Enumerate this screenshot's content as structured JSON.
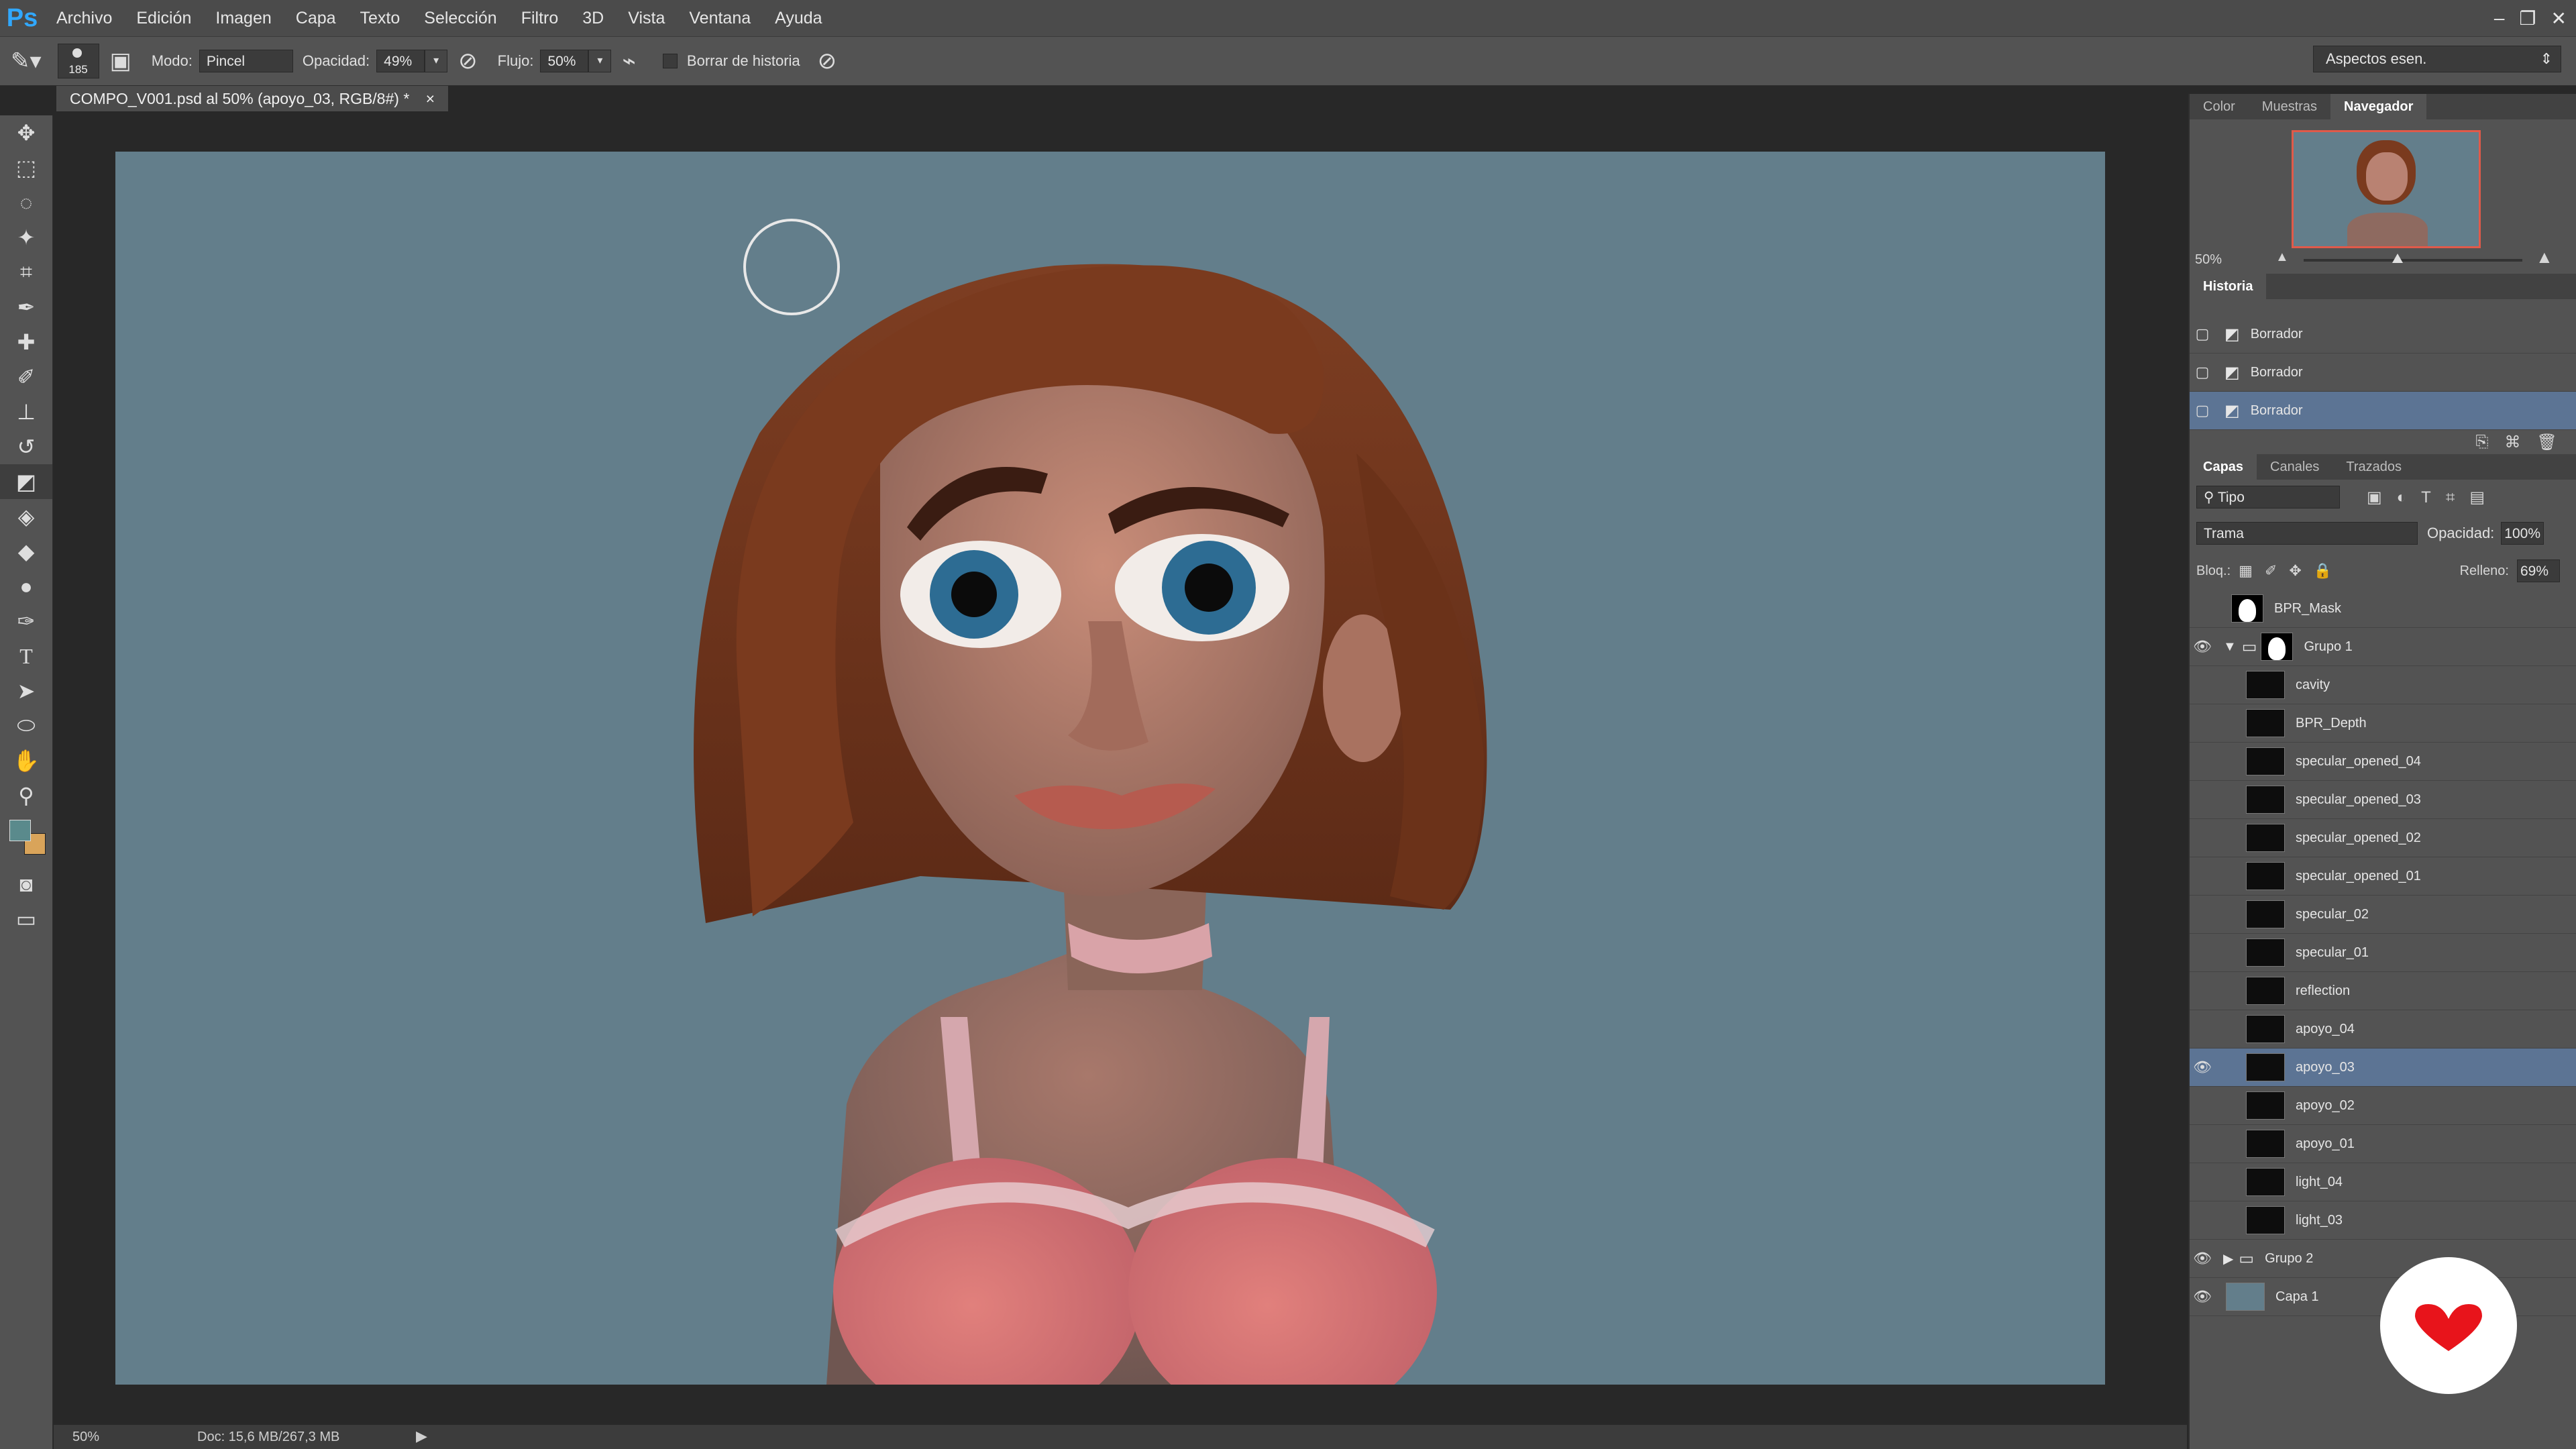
{
  "app": {
    "logo": "Ps"
  },
  "menu": [
    "Archivo",
    "Edición",
    "Imagen",
    "Capa",
    "Texto",
    "Selección",
    "Filtro",
    "3D",
    "Vista",
    "Ventana",
    "Ayuda"
  ],
  "window_controls": {
    "minimize": "‒",
    "restore": "❐",
    "close": "✕"
  },
  "options": {
    "brush_size": "185",
    "mode_label": "Modo:",
    "mode_value": "Pincel",
    "opacity_label": "Opacidad:",
    "opacity_value": "49%",
    "flow_label": "Flujo:",
    "flow_value": "50%",
    "erase_history_label": "Borrar de historia",
    "workspace": "Aspectos esen."
  },
  "document": {
    "tab_title": "COMPO_V001.psd al 50% (apoyo_03, RGB/8#) *",
    "tab_close": "×",
    "zoom": "50%",
    "doc_info": "Doc: 15,6 MB/267,3 MB",
    "canvas_color": "#637e8b"
  },
  "tools": [
    "move-icon",
    "marquee-icon",
    "lasso-icon",
    "magic-wand-icon",
    "crop-icon",
    "eyedropper-icon",
    "healing-icon",
    "brush-icon",
    "stamp-icon",
    "history-brush-icon",
    "eraser-icon",
    "bucket-icon",
    "blur-icon",
    "dodge-icon",
    "pen-icon",
    "type-icon",
    "path-select-icon",
    "ellipse-icon",
    "hand-icon",
    "zoom-icon"
  ],
  "colors": {
    "foreground": "#5a8a8c",
    "background": "#d9a45a"
  },
  "navigator": {
    "tabs": [
      "Color",
      "Muestras",
      "Navegador"
    ],
    "active_tab": "Navegador",
    "zoom": "50%"
  },
  "history": {
    "title": "Historia",
    "items": [
      {
        "label": "Borrador"
      },
      {
        "label": "Borrador"
      },
      {
        "label": "Borrador"
      }
    ]
  },
  "layers_panel": {
    "tabs": [
      "Capas",
      "Canales",
      "Trazados"
    ],
    "filter": "Tipo",
    "blend_mode": "Trama",
    "opacity_label": "Opacidad:",
    "opacity_value": "100%",
    "lock_label": "Bloq.:",
    "fill_label": "Relleno:",
    "fill_value": "69%",
    "layers": [
      {
        "name": "BPR_Mask",
        "visible": false
      },
      {
        "name": "Grupo 1",
        "visible": true,
        "group": true,
        "open": true
      },
      {
        "name": "cavity",
        "visible": false
      },
      {
        "name": "BPR_Depth",
        "visible": false
      },
      {
        "name": "specular_opened_04",
        "visible": false
      },
      {
        "name": "specular_opened_03",
        "visible": false
      },
      {
        "name": "specular_opened_02",
        "visible": false
      },
      {
        "name": "specular_opened_01",
        "visible": false
      },
      {
        "name": "specular_02",
        "visible": false
      },
      {
        "name": "specular_01",
        "visible": false
      },
      {
        "name": "reflection",
        "visible": false
      },
      {
        "name": "apoyo_04",
        "visible": false
      },
      {
        "name": "apoyo_03",
        "visible": true,
        "selected": true
      },
      {
        "name": "apoyo_02",
        "visible": false
      },
      {
        "name": "apoyo_01",
        "visible": false
      },
      {
        "name": "light_04",
        "visible": false
      },
      {
        "name": "light_03",
        "visible": false
      },
      {
        "name": "Grupo 2",
        "visible": true,
        "group": true,
        "open": false
      },
      {
        "name": "Capa 1",
        "visible": true
      }
    ]
  }
}
